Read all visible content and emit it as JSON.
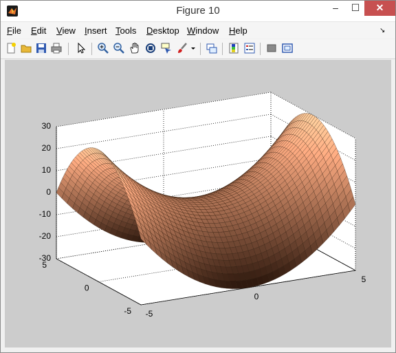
{
  "window": {
    "title": "Figure 10",
    "minimize": "–",
    "maximize": "☐",
    "close": "✕"
  },
  "menu": [
    {
      "label": "File",
      "key": "F",
      "rest": "ile"
    },
    {
      "label": "Edit",
      "key": "E",
      "rest": "dit"
    },
    {
      "label": "View",
      "key": "V",
      "rest": "iew"
    },
    {
      "label": "Insert",
      "key": "I",
      "rest": "nsert"
    },
    {
      "label": "Tools",
      "key": "T",
      "rest": "ools"
    },
    {
      "label": "Desktop",
      "key": "D",
      "rest": "esktop"
    },
    {
      "label": "Window",
      "key": "W",
      "rest": "indow"
    },
    {
      "label": "Help",
      "key": "H",
      "rest": "elp"
    }
  ],
  "menu_dock_glyph": "↘",
  "toolbar_icons": [
    "new-figure-icon",
    "open-file-icon",
    "save-figure-icon",
    "print-figure-icon",
    "edit-plot-arrow-icon",
    "zoom-in-icon",
    "zoom-out-icon",
    "pan-hand-icon",
    "rotate-3d-icon",
    "data-cursor-icon",
    "brush-icon",
    "brush-dropdown-icon",
    "link-plot-icon",
    "insert-colorbar-icon",
    "insert-legend-icon",
    "hide-plot-tools-icon",
    "show-plot-tools-icon"
  ],
  "colors": {
    "surface_light": "#ffd9b3",
    "surface_mid": "#f0a070",
    "surface_dark": "#3a2010",
    "axes_background": "#ffffff",
    "figure_background": "#cccccc"
  },
  "chart_data": {
    "type": "surface",
    "function": "z = x^2 - y^2 style saddle",
    "zticks": [
      "30",
      "20",
      "10",
      "0",
      "-10",
      "-20",
      "-30"
    ],
    "yticks": [
      "5",
      "0",
      "-5"
    ],
    "xticks": [
      "-5",
      "0",
      "5"
    ],
    "xlim": [
      -5,
      5
    ],
    "ylim": [
      -5,
      5
    ],
    "zlim": [
      -30,
      30
    ],
    "grid": true,
    "colormap": "copper"
  }
}
